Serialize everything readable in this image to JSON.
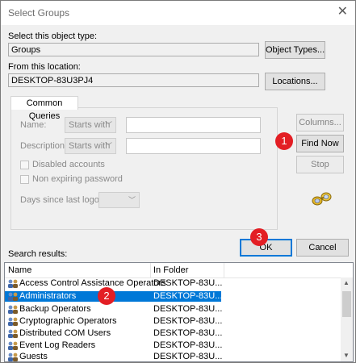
{
  "window": {
    "title": "Select Groups",
    "close_glyph": "✕"
  },
  "object_type": {
    "label": "Select this object type:",
    "value": "Groups",
    "button": "Object Types..."
  },
  "location": {
    "label": "From this location:",
    "value": "DESKTOP-83U3PJ4",
    "button": "Locations..."
  },
  "common_queries": {
    "tab_label": "Common Queries",
    "name_label": "Name:",
    "name_mode": "Starts with",
    "description_label": "Description:",
    "description_mode": "Starts with",
    "disabled_accounts_label": "Disabled accounts",
    "non_expiring_label": "Non expiring password",
    "days_label": "Days since last logon:"
  },
  "side_buttons": {
    "columns": "Columns...",
    "find_now": "Find Now",
    "stop": "Stop"
  },
  "dialog_buttons": {
    "ok": "OK",
    "cancel": "Cancel"
  },
  "callouts": [
    "1",
    "2",
    "3"
  ],
  "results": {
    "label": "Search results:",
    "columns": [
      "Name",
      "In Folder"
    ],
    "rows": [
      {
        "name": "Access Control Assistance Operators",
        "folder": "DESKTOP-83U..."
      },
      {
        "name": "Administrators",
        "folder": "DESKTOP-83U..."
      },
      {
        "name": "Backup Operators",
        "folder": "DESKTOP-83U..."
      },
      {
        "name": "Cryptographic Operators",
        "folder": "DESKTOP-83U..."
      },
      {
        "name": "Distributed COM Users",
        "folder": "DESKTOP-83U..."
      },
      {
        "name": "Event Log Readers",
        "folder": "DESKTOP-83U..."
      },
      {
        "name": "Guests",
        "folder": "DESKTOP-83U..."
      }
    ],
    "selected_index": 1
  },
  "colors": {
    "accent": "#0078d7",
    "callout": "#e31e24",
    "selection": "#cce8ff"
  },
  "icons": [
    "close-icon",
    "group-icon",
    "search-binoculars-icon",
    "chevron-down-icon",
    "scroll-up-icon",
    "scroll-down-icon"
  ]
}
